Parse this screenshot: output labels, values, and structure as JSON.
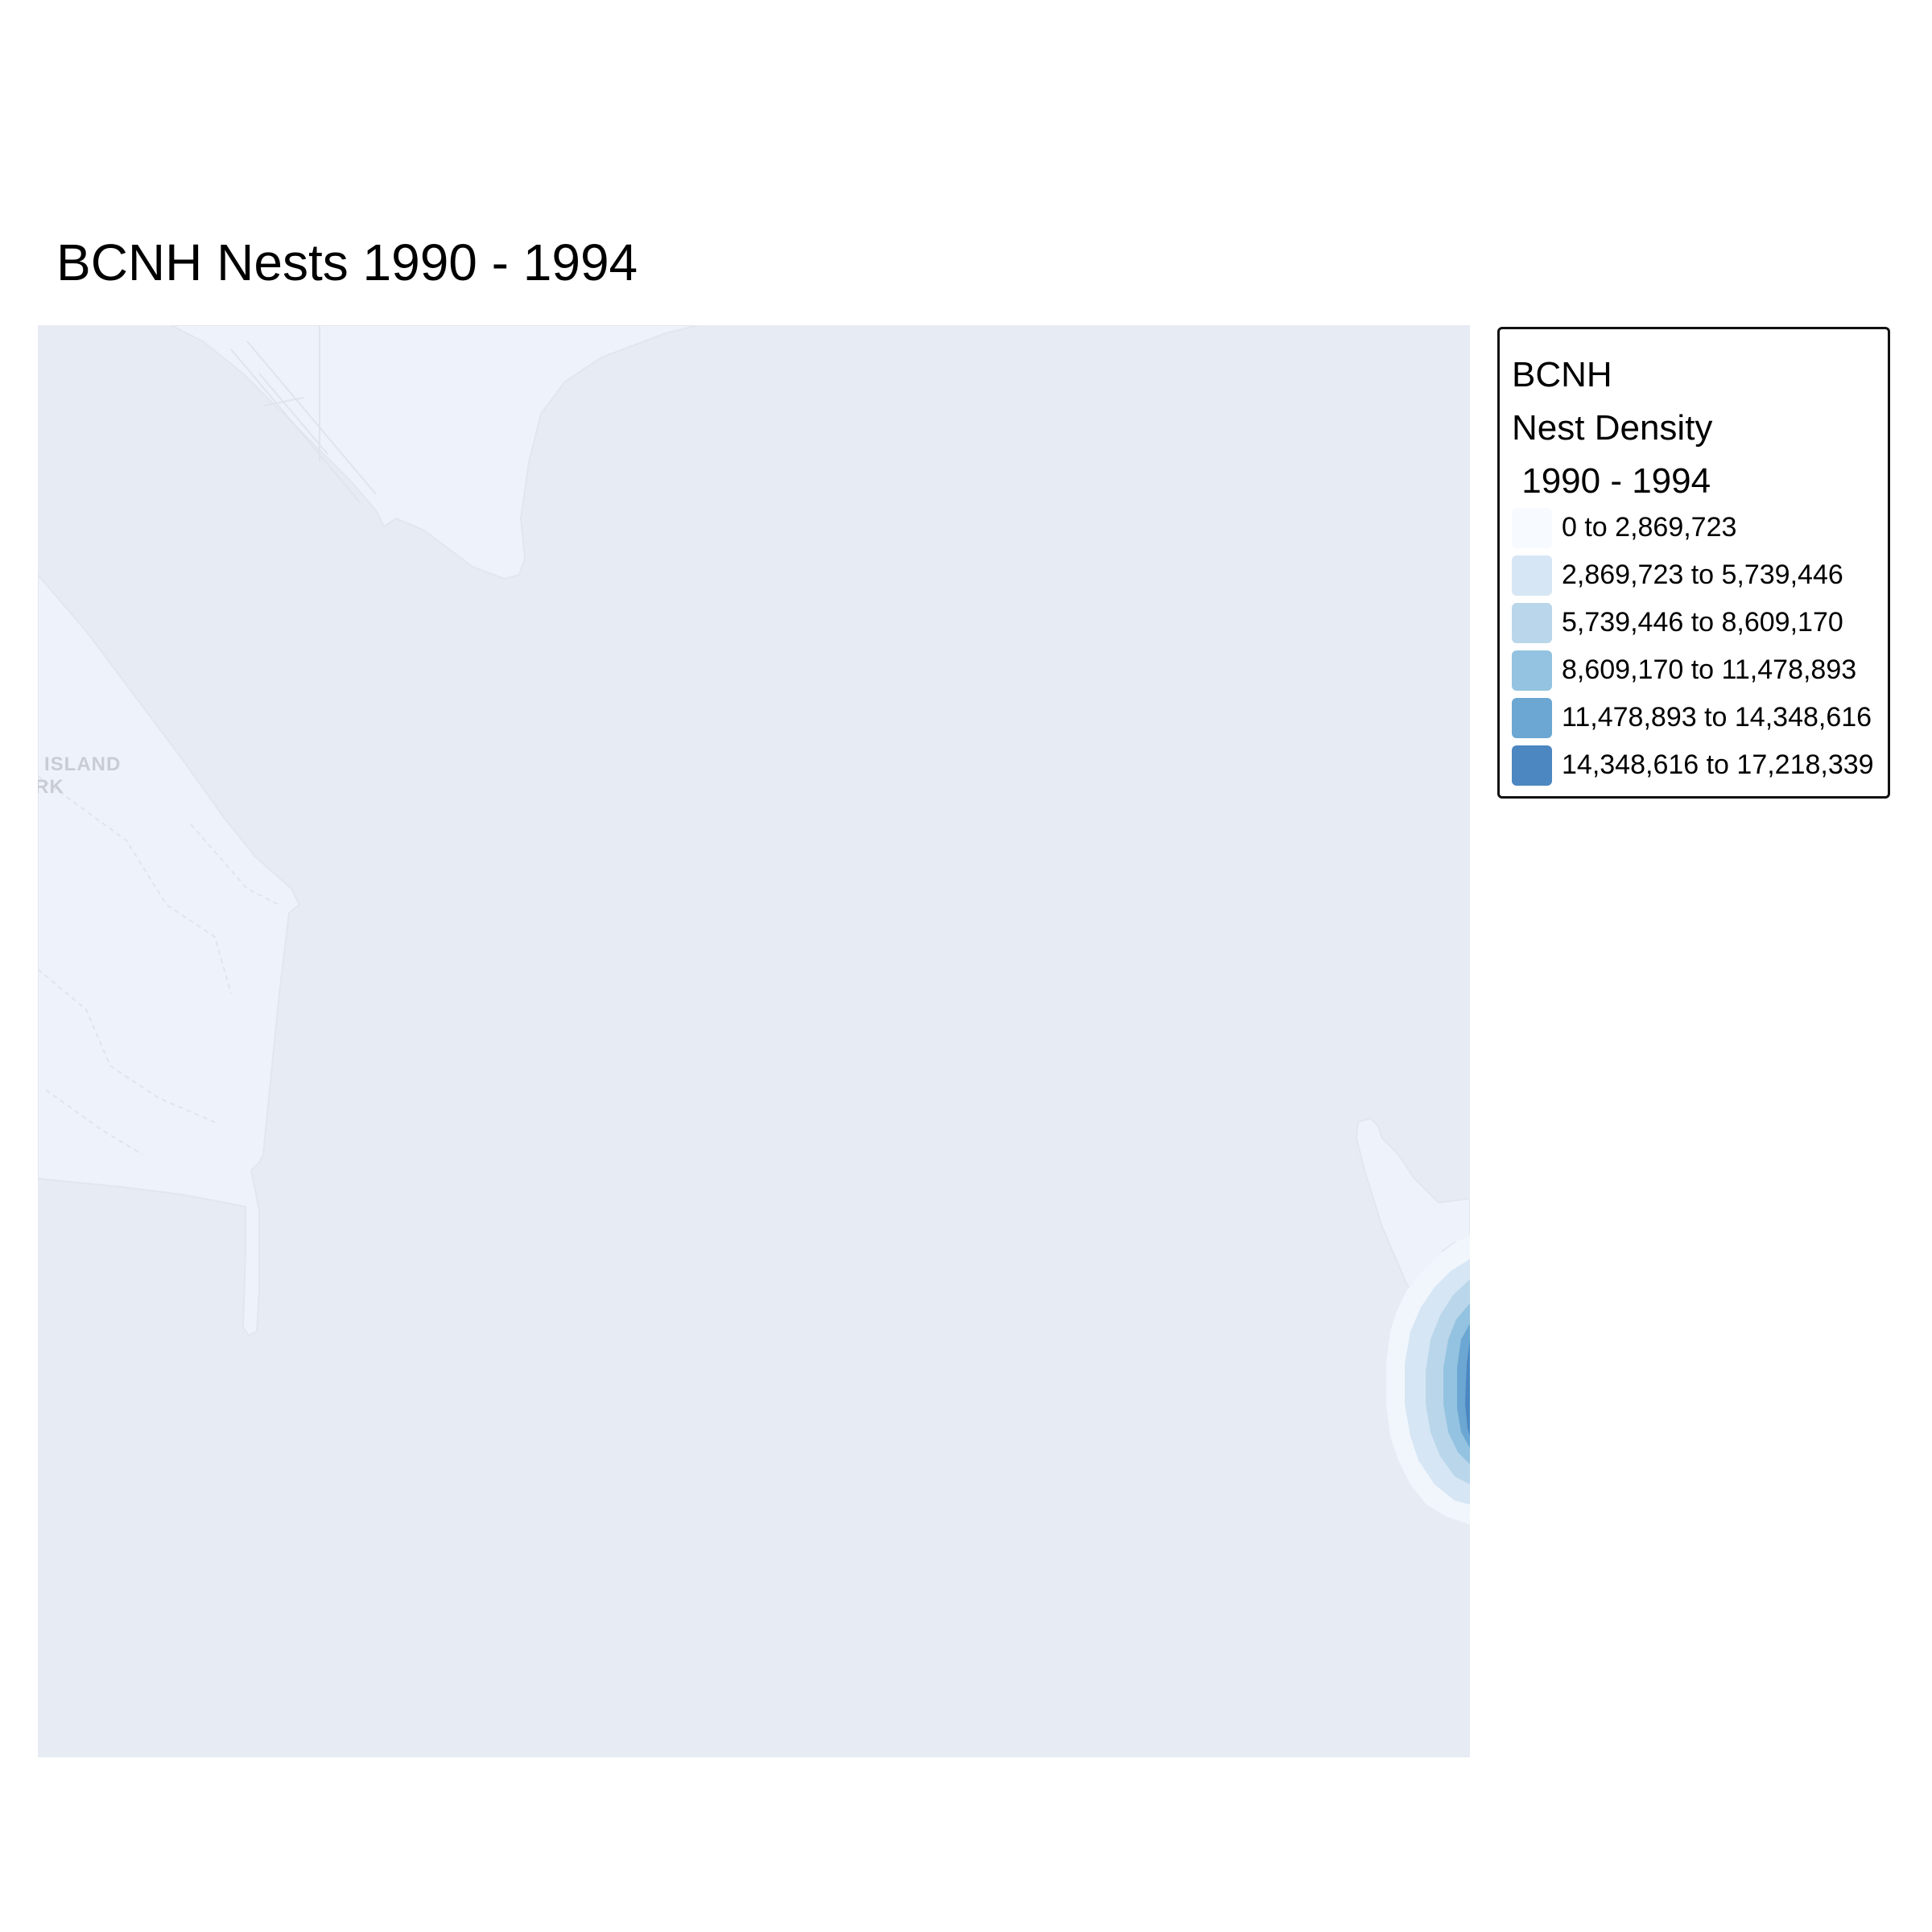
{
  "title": "BCNH Nests 1990 - 1994",
  "map": {
    "basemap_labels": [
      "ISLAND",
      "RK"
    ],
    "colors": {
      "water": "#e7ebf3",
      "land": "#eef2fa",
      "land_edge": "#e2e6ee",
      "road": "#dfe3ea"
    },
    "density_hotspot": {
      "position": "right edge, lower middle",
      "class_colors": [
        "#f7fbff",
        "#d6e6f4",
        "#bad6ea",
        "#93c3e0",
        "#6ba7d2",
        "#4c87c1"
      ]
    }
  },
  "legend": {
    "title_lines": [
      "BCNH",
      "Nest Density",
      " 1990 - 1994"
    ],
    "items": [
      {
        "label": "0 to 2,869,723",
        "color": "#f7fbff"
      },
      {
        "label": "2,869,723 to 5,739,446",
        "color": "#d6e6f4"
      },
      {
        "label": "5,739,446 to 8,609,170",
        "color": "#bad6ea"
      },
      {
        "label": "8,609,170 to 11,478,893",
        "color": "#93c3e0"
      },
      {
        "label": "11,478,893 to 14,348,616",
        "color": "#6ba7d2"
      },
      {
        "label": "14,348,616 to 17,218,339",
        "color": "#4c87c1"
      }
    ]
  }
}
